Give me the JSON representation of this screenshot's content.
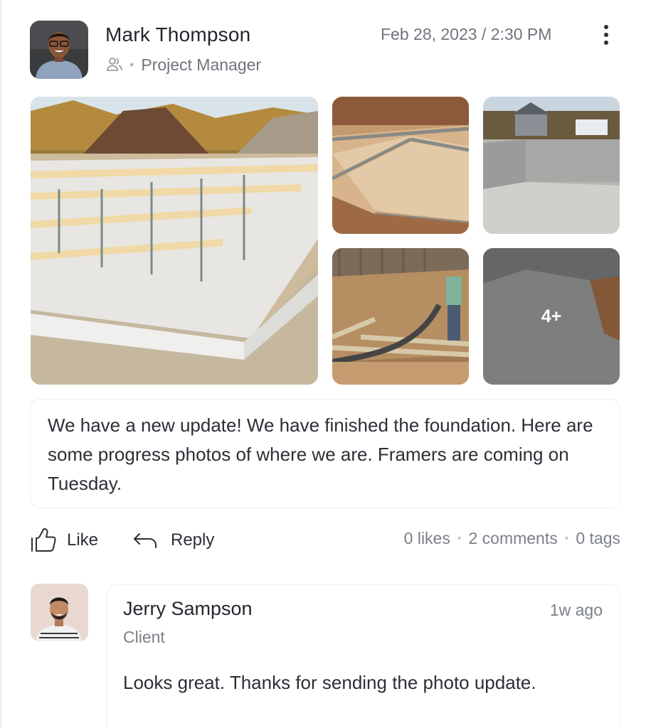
{
  "post": {
    "author": {
      "name": "Mark Thompson",
      "role": "Project Manager",
      "role_icon": "people-icon"
    },
    "timestamp": "Feb 28, 2023 / 2:30 PM",
    "more_icon": "more-vertical-icon",
    "gallery": {
      "photo_count_visible": 5,
      "more_label": "4+"
    },
    "text": "We have a new update! We have finished the foundation. Here are some progress photos of where we are. Framers are coming on Tuesday.",
    "actions": {
      "like_label": "Like",
      "like_icon": "thumbs-up-icon",
      "reply_label": "Reply",
      "reply_icon": "reply-arrow-icon"
    },
    "stats": {
      "likes": "0 likes",
      "comments": "2 comments",
      "tags": "0 tags"
    }
  },
  "comments": [
    {
      "name": "Jerry Sampson",
      "role": "Client",
      "time": "1w ago",
      "text": "Looks great. Thanks for sending the photo update."
    }
  ],
  "colors": {
    "text_primary": "#2b2f36",
    "text_secondary": "#6f747c",
    "border": "#eceef1"
  }
}
